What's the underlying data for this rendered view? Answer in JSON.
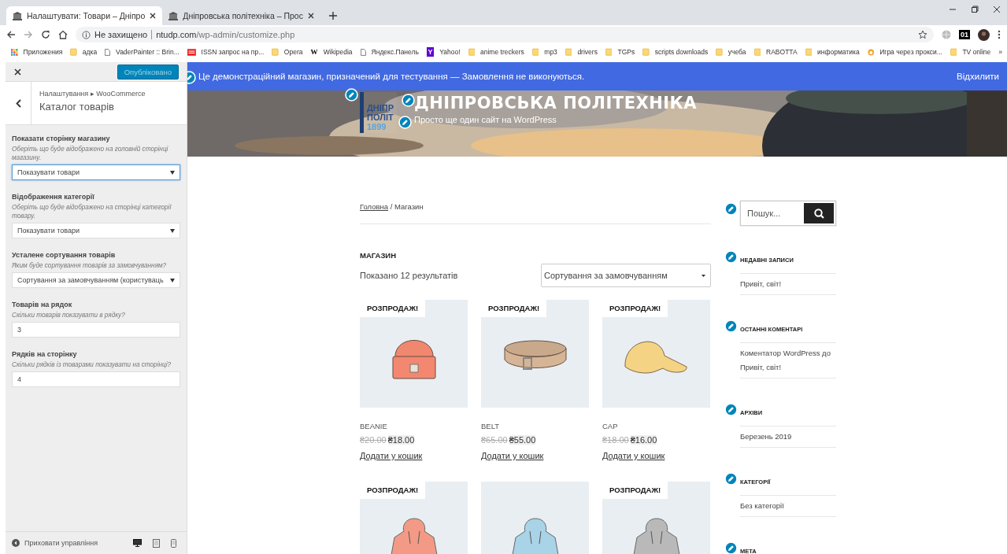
{
  "browser": {
    "tabs": [
      {
        "title": "Налаштувати: Товари – Дніпро",
        "selected": true
      },
      {
        "title": "Дніпровська політехніка – Прос",
        "selected": false
      }
    ],
    "security": "Не захищено",
    "url_host": "ntudp.com",
    "url_path": "/wp-admin/customize.php",
    "extension_badge": "01",
    "bookmarks": [
      {
        "label": "Приложения",
        "kind": "apps"
      },
      {
        "label": "адка",
        "kind": "folder"
      },
      {
        "label": "VaderPainter :: Brin...",
        "kind": "page"
      },
      {
        "label": "ISSN запрос на пр...",
        "kind": "red"
      },
      {
        "label": "Opera",
        "kind": "folder"
      },
      {
        "label": "Wikipedia",
        "kind": "letter",
        "icon_text": "W"
      },
      {
        "label": "Яндекс.Панель",
        "kind": "page"
      },
      {
        "label": "Yahoo!",
        "kind": "badge",
        "icon_text": "Y"
      },
      {
        "label": "anime treckers",
        "kind": "folder"
      },
      {
        "label": "mp3",
        "kind": "folder"
      },
      {
        "label": "drivers",
        "kind": "folder"
      },
      {
        "label": "TGPs",
        "kind": "folder"
      },
      {
        "label": "scripts downloads",
        "kind": "folder"
      },
      {
        "label": "учеба",
        "kind": "folder"
      },
      {
        "label": "RABOTTA",
        "kind": "folder"
      },
      {
        "label": "информатика",
        "kind": "folder"
      },
      {
        "label": "Игра через прокси...",
        "kind": "flame"
      },
      {
        "label": "TV online",
        "kind": "folder"
      }
    ],
    "more": "»"
  },
  "customizer": {
    "publish_button": "Опубліковано",
    "breadcrumb": "Налаштування ▸ WooCommerce",
    "title": "Каталог товарів",
    "controls": [
      {
        "kind": "select",
        "label": "Показати сторінку магазину",
        "description": "Оберіть що буде відображено на головній сторінці магазину.",
        "value": "Показувати товари",
        "focused": true
      },
      {
        "kind": "select",
        "label": "Відображення категорії",
        "description": "Оберіть що буде відображено на сторінці категорії товару.",
        "value": "Показувати товари",
        "focused": false
      },
      {
        "kind": "select",
        "label": "Усталене сортування товарів",
        "description": "Яким буде сортування товарів за замовчуванням?",
        "value": "Сортування за замовчуванням (користуваць",
        "focused": false
      },
      {
        "kind": "number",
        "label": "Товарів на рядок",
        "description": "Скільки товарів показувати в рядку?",
        "value": "3",
        "focused": false
      },
      {
        "kind": "number",
        "label": "Рядків на сторінку",
        "description": "Скільки рядків із товарами показувати на сторінці?",
        "value": "4",
        "focused": false
      }
    ],
    "hide_controls": "Приховати управління",
    "devices": [
      {
        "kind": "desktop",
        "selected": true
      },
      {
        "kind": "tablet",
        "selected": false
      },
      {
        "kind": "mobile",
        "selected": false
      }
    ]
  },
  "preview": {
    "store_notice": "Це демонстраційний магазин, призначений для тестування — Замовлення не виконуються.",
    "dismiss": "Відхилити",
    "logo_lines": [
      "ДНІПР",
      "ПОЛІТ",
      "1899"
    ],
    "site_title": "ДНІПРОВСЬКА ПОЛІТЕХНІКА",
    "tagline": "Просто ще один сайт на WordPress",
    "breadcrumb": {
      "home": "Головна",
      "current": "/ Магазин"
    },
    "page_title": "МАГАЗИН",
    "result_count": "Показано 12 результатів",
    "ordering": "Сортування за замовчуванням",
    "products": [
      {
        "kind": "beanie",
        "on_sale": true,
        "sale_label": "РОЗПРОДАЖ!",
        "name": "BEANIE",
        "old_price": "₴20.00",
        "price": "₴18.00",
        "button": "Додати у кошик"
      },
      {
        "kind": "belt",
        "on_sale": true,
        "sale_label": "РОЗПРОДАЖ!",
        "name": "BELT",
        "old_price": "₴65.00",
        "price": "₴55.00",
        "button": "Додати у кошик"
      },
      {
        "kind": "cap",
        "on_sale": true,
        "sale_label": "РОЗПРОДАЖ!",
        "name": "CAP",
        "old_price": "₴18.00",
        "price": "₴16.00",
        "button": "Додати у кошик"
      },
      {
        "kind": "hoodie",
        "color": "#f29a86",
        "on_sale": true,
        "sale_label": "РОЗПРОДАЖ!"
      },
      {
        "kind": "hoodie",
        "color": "#a9d3e6",
        "on_sale": false
      },
      {
        "kind": "hoodie",
        "color": "#b9b9b9",
        "on_sale": true,
        "sale_label": "РОЗПРОДАЖ!"
      }
    ],
    "search_placeholder": "Пошук...",
    "widgets": [
      {
        "title": "НЕДАВНІ ЗАПИСИ",
        "items": [
          "Привіт, світ!"
        ]
      },
      {
        "title": "ОСТАННІ КОМЕНТАРІ",
        "items": [
          "Коментатор WordPress до Привіт, світ!"
        ]
      },
      {
        "title": "АРХІВИ",
        "items": [
          "Березень 2019"
        ]
      },
      {
        "title": "КАТЕГОРІЇ",
        "items": [
          "Без категорії"
        ]
      },
      {
        "title": "МЕТА"
      }
    ]
  }
}
